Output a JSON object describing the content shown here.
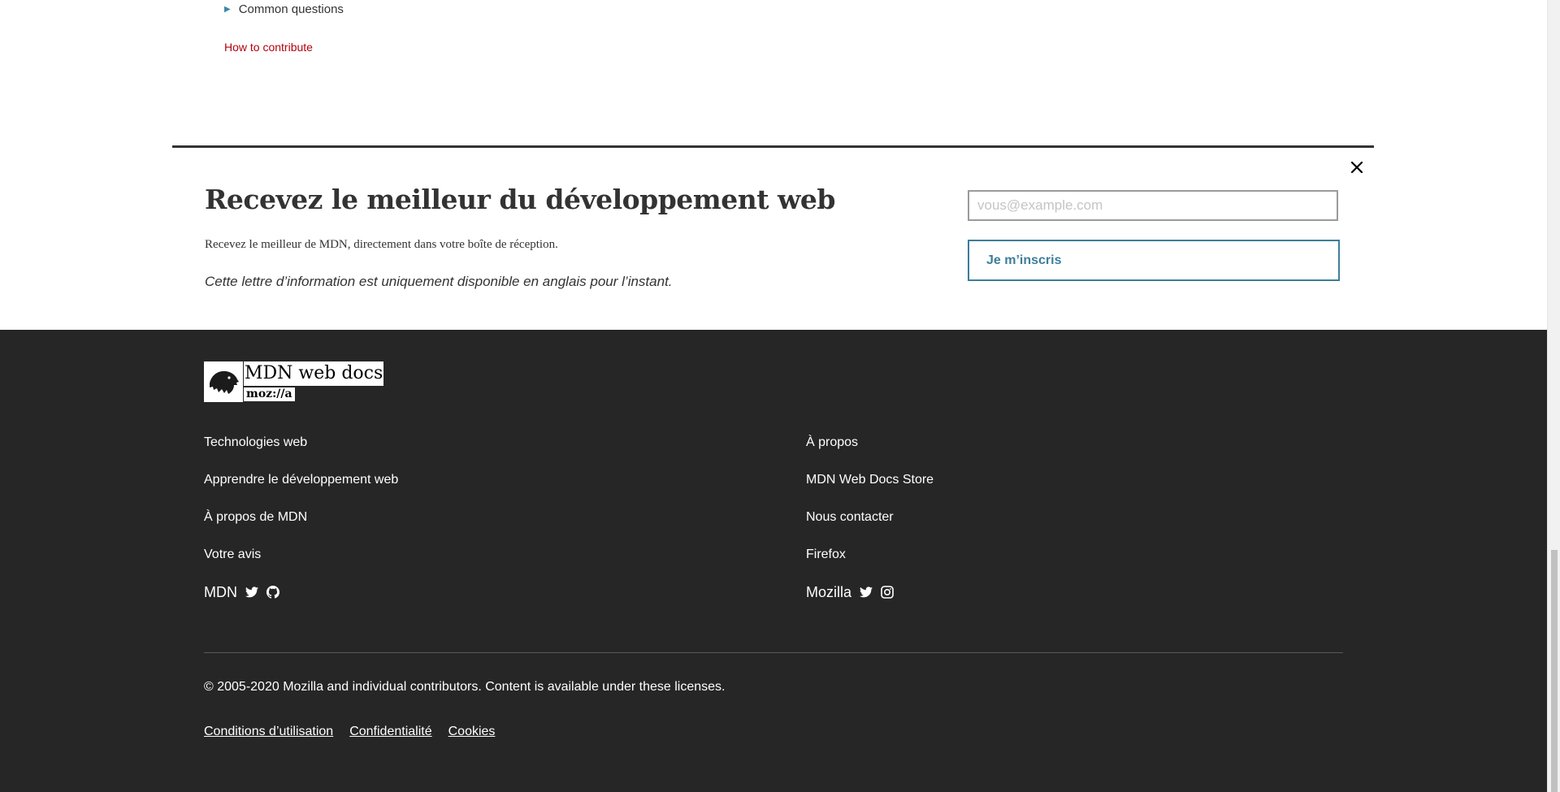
{
  "sidebar": {
    "toc_item": "Common questions",
    "contribute_link": "How to contribute"
  },
  "newsletter": {
    "title": "Recevez le meilleur du développement web",
    "description": "Recevez le meilleur de MDN, directement dans votre boîte de réception.",
    "note": "Cette lettre d’information est uniquement disponible en anglais pour l’instant.",
    "email_placeholder": "vous@example.com",
    "email_value": "",
    "submit_label": "Je m’inscris",
    "close_icon": "close-icon"
  },
  "footer": {
    "logo": {
      "title": "MDN web docs",
      "subtitle": "moz://a"
    },
    "left_links": [
      "Technologies web",
      "Apprendre le développement web",
      "À propos de MDN",
      "Votre avis"
    ],
    "right_links": [
      "À propos",
      "MDN Web Docs Store",
      "Nous contacter",
      "Firefox"
    ],
    "left_social": {
      "label": "MDN",
      "icons": [
        "twitter-icon",
        "github-icon"
      ]
    },
    "right_social": {
      "label": "Mozilla",
      "icons": [
        "twitter-icon",
        "instagram-icon"
      ]
    },
    "copyright": "© 2005-2020 Mozilla and individual contributors. Content is available under these licenses.",
    "legal_links": [
      "Conditions d’utilisation",
      "Confidentialité",
      "Cookies"
    ]
  },
  "colors": {
    "footer_bg": "#262626",
    "link_red": "#b4010e",
    "accent_blue": "#3d7e9a",
    "text_dark": "#333333"
  }
}
